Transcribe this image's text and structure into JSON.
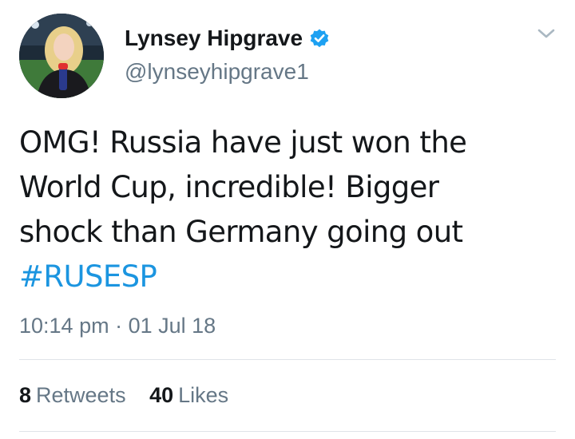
{
  "user": {
    "display_name": "Lynsey Hipgrave",
    "handle": "@lynseyhipgrave1",
    "verified": true,
    "avatar_icon": "profile-photo"
  },
  "tweet": {
    "lines": [
      "OMG! Russia have just won the",
      "World Cup, incredible! Bigger",
      "shock than Germany going out"
    ],
    "hashtag": "#RUSESP",
    "time": "10:14 pm",
    "separator": "·",
    "date": "01 Jul 18"
  },
  "stats": {
    "retweets_count": "8",
    "retweets_label": "Retweets",
    "likes_count": "40",
    "likes_label": "Likes"
  },
  "icons": {
    "verified": "verified-badge-icon",
    "menu": "chevron-down-icon"
  },
  "colors": {
    "accent": "#1b95e0",
    "text": "#14171a",
    "secondary": "#657786",
    "divider": "#dfe3e8"
  }
}
